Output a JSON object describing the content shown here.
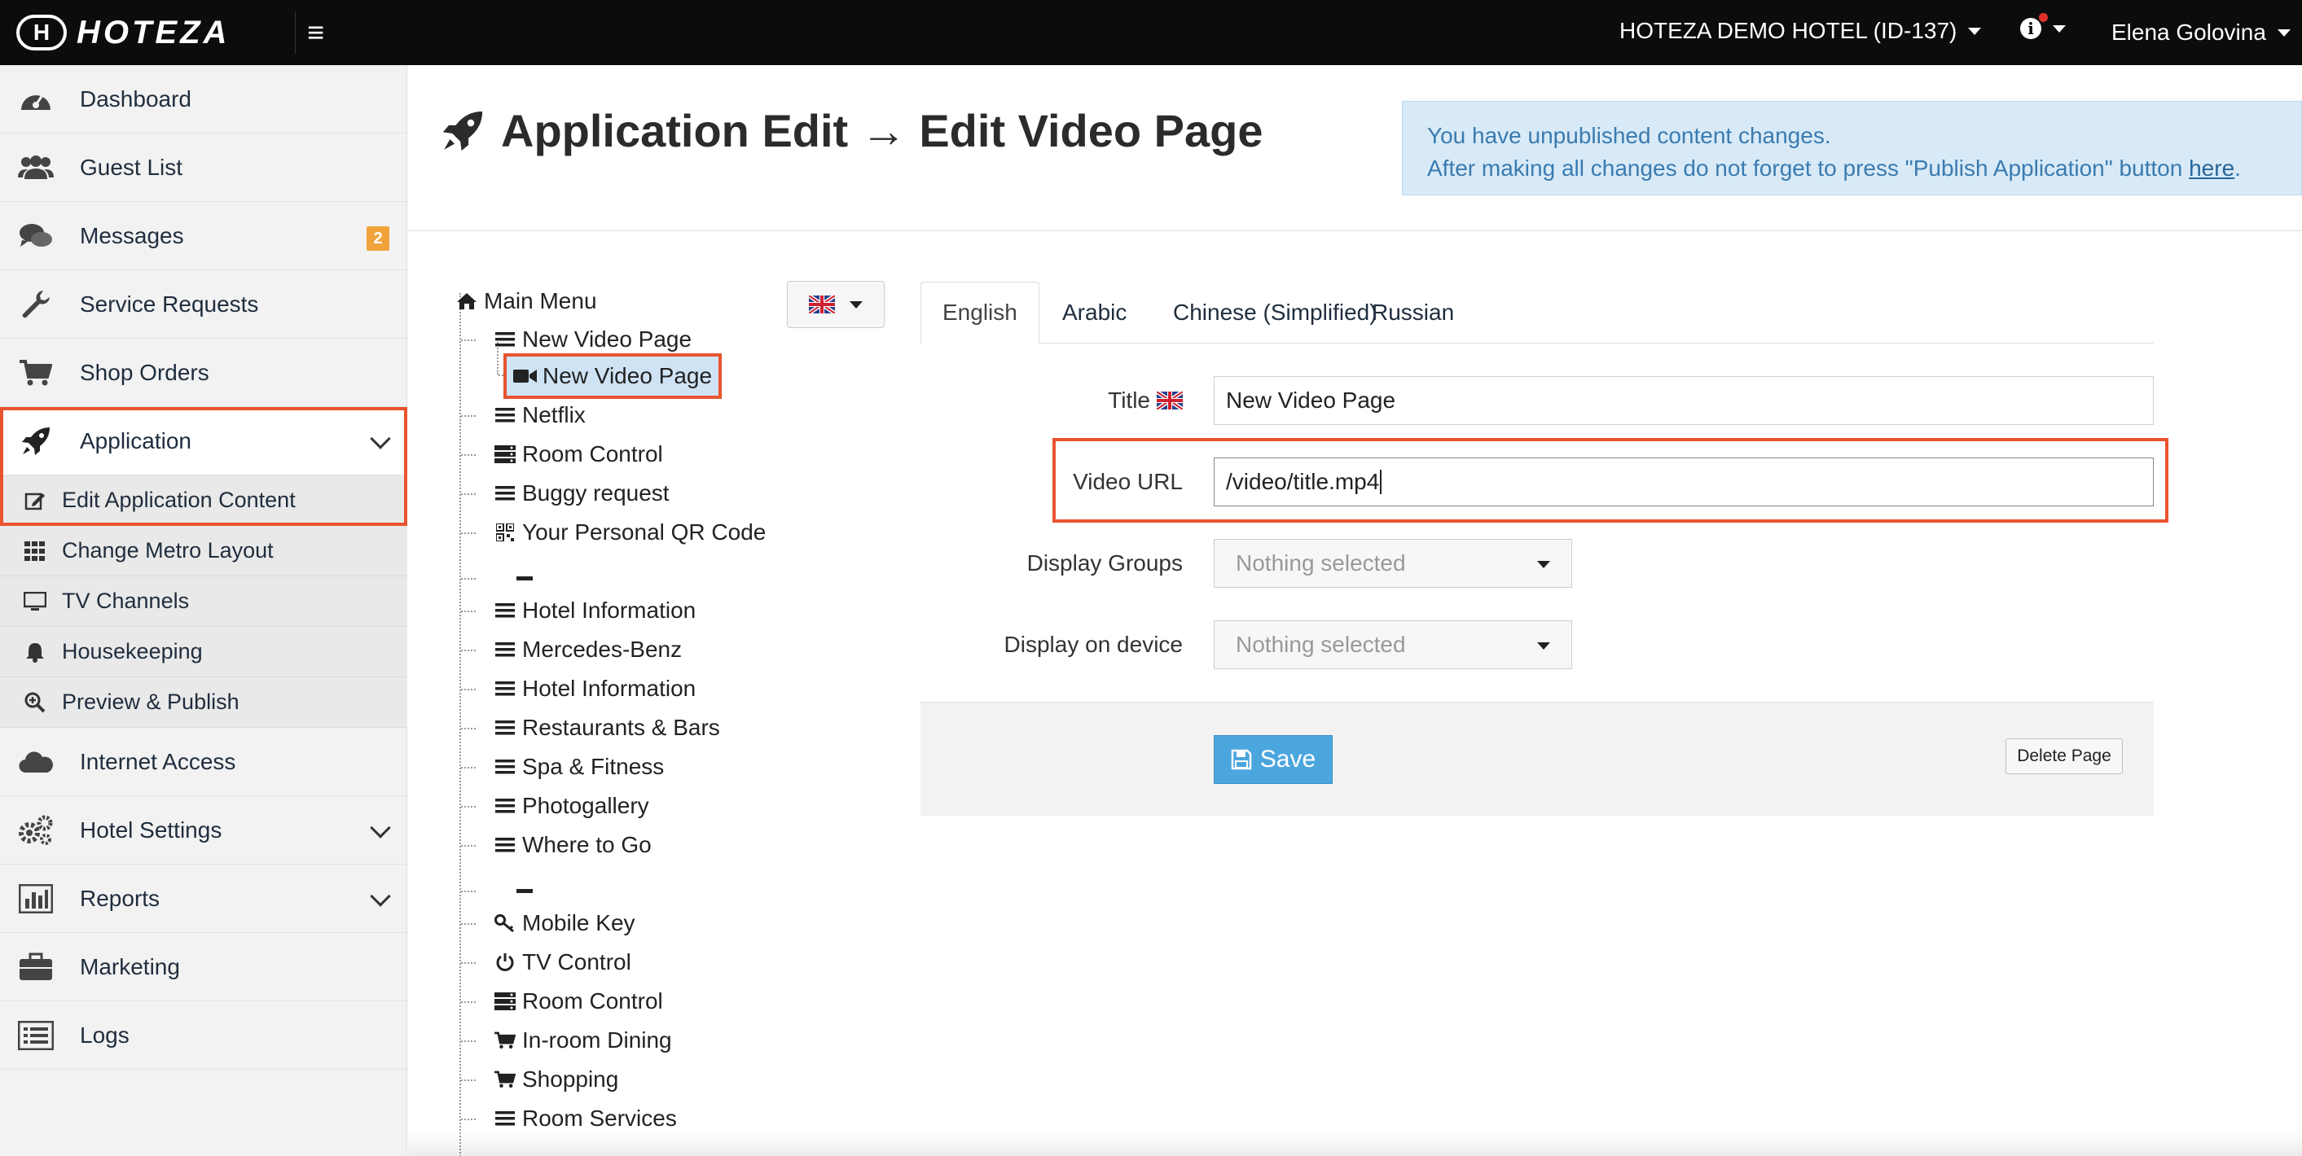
{
  "app": {
    "logo_mark": "H",
    "logo_text": "HOTEZA",
    "hotel_selector": "HOTEZA DEMO HOTEL (ID-137)",
    "user_name": "Elena Golovina",
    "info_label": "i"
  },
  "sidebar": {
    "items": [
      {
        "label": "Dashboard",
        "icon": "dashboard-icon"
      },
      {
        "label": "Guest List",
        "icon": "users-icon"
      },
      {
        "label": "Messages",
        "icon": "comments-icon",
        "badge": "2"
      },
      {
        "label": "Service Requests",
        "icon": "wrench-icon"
      },
      {
        "label": "Shop Orders",
        "icon": "cart-icon"
      },
      {
        "label": "Application",
        "icon": "rocket-icon",
        "expanded": true
      },
      {
        "label": "Internet Access",
        "icon": "cloud-icon"
      },
      {
        "label": "Hotel Settings",
        "icon": "gears-icon"
      },
      {
        "label": "Reports",
        "icon": "bar-chart-icon"
      },
      {
        "label": "Marketing",
        "icon": "briefcase-icon"
      },
      {
        "label": "Logs",
        "icon": "list-icon"
      }
    ],
    "sub_items": [
      {
        "label": "Edit Application Content",
        "icon": "edit-icon"
      },
      {
        "label": "Change Metro Layout",
        "icon": "grid-icon"
      },
      {
        "label": "TV Channels",
        "icon": "monitor-icon"
      },
      {
        "label": "Housekeeping",
        "icon": "bell-icon"
      },
      {
        "label": "Preview & Publish",
        "icon": "search-plus-icon"
      }
    ]
  },
  "header": {
    "title": "Application Edit → Edit Video Page",
    "alert_line1": "You have unpublished content changes.",
    "alert_line2": "After making all changes do not forget to press \"Publish Application\" button ",
    "alert_link": "here",
    "alert_end": "."
  },
  "tree": {
    "root": "Main Menu",
    "nodes": [
      {
        "label": "New Video Page",
        "icon": "bars-icon"
      },
      {
        "label": "New Video Page",
        "icon": "video-icon",
        "selected": true
      },
      {
        "label": "Netflix",
        "icon": "bars-icon"
      },
      {
        "label": "Room Control",
        "icon": "server-icon"
      },
      {
        "label": "Buggy request",
        "icon": "bars-icon"
      },
      {
        "label": "Your Personal QR Code",
        "icon": "qrcode-icon"
      },
      {
        "label": "Hotel Information",
        "icon": "bars-icon"
      },
      {
        "label": "Mercedes-Benz",
        "icon": "bars-icon"
      },
      {
        "label": "Hotel Information",
        "icon": "bars-icon"
      },
      {
        "label": "Restaurants & Bars",
        "icon": "bars-icon"
      },
      {
        "label": "Spa & Fitness",
        "icon": "bars-icon"
      },
      {
        "label": "Photogallery",
        "icon": "bars-icon"
      },
      {
        "label": "Where to Go",
        "icon": "bars-icon"
      },
      {
        "label": "Mobile Key",
        "icon": "key-icon"
      },
      {
        "label": "TV Control",
        "icon": "power-icon"
      },
      {
        "label": "Room Control",
        "icon": "server-icon"
      },
      {
        "label": "In-room Dining",
        "icon": "cart-icon"
      },
      {
        "label": "Shopping",
        "icon": "cart-icon"
      },
      {
        "label": "Room Services",
        "icon": "bars-icon"
      }
    ]
  },
  "tabs": [
    "English",
    "Arabic",
    "Chinese (Simplified)",
    "Russian"
  ],
  "form": {
    "title_label": "Title",
    "title_value": "New Video Page",
    "video_url_label": "Video URL",
    "video_url_value": "/video/title.mp4",
    "display_groups_label": "Display Groups",
    "display_groups_value": "Nothing selected",
    "display_device_label": "Display on device",
    "display_device_value": "Nothing selected",
    "save_label": "Save",
    "delete_label": "Delete Page"
  },
  "colors": {
    "accent_highlight": "#e8542f",
    "save_button": "#4ca6de",
    "badge": "#f0a33b",
    "alert_bg": "#d8eaf7"
  }
}
